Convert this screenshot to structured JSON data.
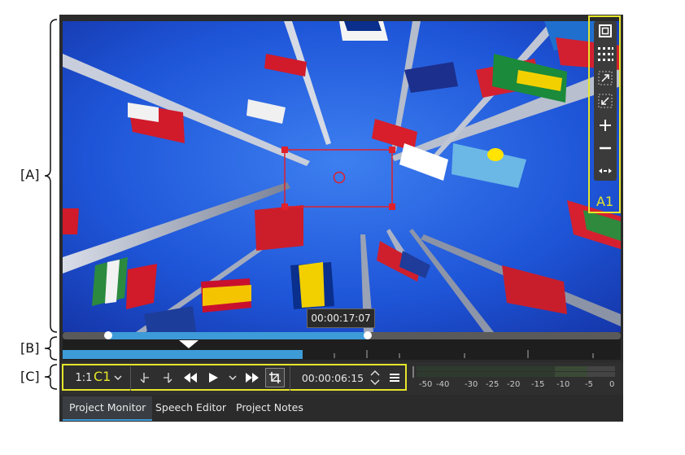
{
  "callouts": {
    "a": "[A]",
    "b": "[B]",
    "c": "[C]"
  },
  "toolbar_tag": "A1",
  "zoom_tag": "C1",
  "monitor": {
    "hover_timecode": "00:00:17:07",
    "zoom_label": "1:1",
    "timecode": "00:00:06:15"
  },
  "vu_scale": [
    "-50",
    "-40",
    "-30",
    "-25",
    "-20",
    "-15",
    "-10",
    "-5",
    "0"
  ],
  "tabs": [
    {
      "label": "Project Monitor",
      "active": true
    },
    {
      "label": "Speech Editor",
      "active": false
    },
    {
      "label": "Project Notes",
      "active": false
    }
  ],
  "toolbar_icons": [
    "fullscreen-icon",
    "grid-icon",
    "zoom-in-icon",
    "zoom-out-icon",
    "plus-icon",
    "minus-icon",
    "expand-horizontal-icon"
  ],
  "colors": {
    "accent": "#e6e62a",
    "selection": "#e0202a",
    "progress": "#3d9bd8"
  }
}
